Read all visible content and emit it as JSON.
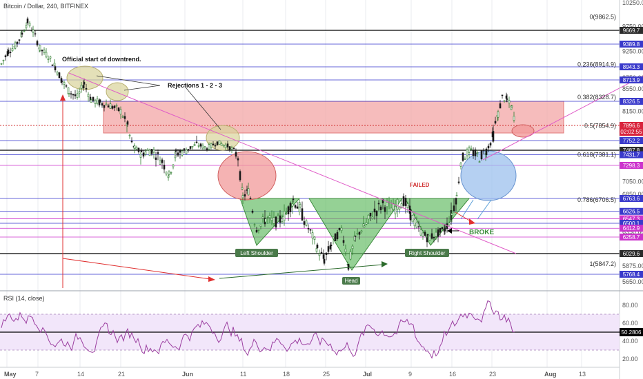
{
  "header": {
    "title": "Bitcoin / Dollar, 240, BITFINEX"
  },
  "rsi_header": {
    "title": "RSI (14, close)"
  },
  "colors": {
    "grid": "#e8ebef",
    "black_line": "#000000",
    "blue_line": "#3333cc",
    "magenta_line": "#cc33cc",
    "red_zone": "#f3a6a6",
    "green_pattern": "#5cb85c",
    "candle_up": "#2a7a2a",
    "candle_down": "#1a1a1a",
    "rsi_line": "#9b3ea0",
    "rsi_band": "#f2e6fa",
    "dark_box": "#2b2b2b",
    "blue_box": "#3a3acb",
    "red_box": "#d9233c",
    "magenta_box": "#cc33cc"
  },
  "chart_data": [
    {
      "type": "candlestick",
      "title": "Bitcoin / Dollar, 240, BITFINEX",
      "x_ticks": [
        "May",
        "7",
        "14",
        "21",
        "Jun",
        "11",
        "18",
        "25",
        "Jul",
        "9",
        "16",
        "23",
        "Aug",
        "13"
      ],
      "y_ticks": [
        10250.0,
        9750.0,
        9250.0,
        8750.0,
        8550.0,
        8150.0,
        7750.0,
        7050.0,
        6850.0,
        6350.0,
        5875.0,
        5650.0
      ],
      "ylim": [
        5600,
        10300
      ],
      "price_labels": [
        {
          "value": 9669.7,
          "color": "dark"
        },
        {
          "value": 9389.8,
          "color": "blue"
        },
        {
          "value": 8943.3,
          "color": "blue"
        },
        {
          "value": 8713.9,
          "color": "blue"
        },
        {
          "value": 8326.5,
          "color": "blue"
        },
        {
          "value": 7896.6,
          "color": "red",
          "text": "7896.6",
          "sub": "02:02:55"
        },
        {
          "value": 7752.2,
          "color": "blue"
        },
        {
          "value": 7487.8,
          "color": "dark"
        },
        {
          "value": 7431.7,
          "color": "blue"
        },
        {
          "value": 7298.3,
          "color": "magenta"
        },
        {
          "value": 6763.6,
          "color": "blue"
        },
        {
          "value": 6626.5,
          "color": "blue"
        },
        {
          "value": 6547.3,
          "color": "magenta"
        },
        {
          "value": 6500.1,
          "color": "blue"
        },
        {
          "value": 6412.9,
          "color": "magenta"
        },
        {
          "value": 6258.7,
          "color": "magenta"
        },
        {
          "value": 6029.6,
          "color": "dark"
        },
        {
          "value": 5768.4,
          "color": "blue"
        }
      ],
      "fib_levels": [
        {
          "ratio": "0",
          "price": 9862.5,
          "label": "0(9862.5)"
        },
        {
          "ratio": "0.236",
          "price": 8914.9,
          "label": "0.236(8914.9)"
        },
        {
          "ratio": "0.382",
          "price": 8328.7,
          "label": "0.382(8328.7)"
        },
        {
          "ratio": "0.5",
          "price": 7854.9,
          "label": "0.5(7854.9)"
        },
        {
          "ratio": "0.618",
          "price": 7381.1,
          "label": "0.618(7381.1)"
        },
        {
          "ratio": "0.786",
          "price": 6706.5,
          "label": "0.786(6706.5)"
        },
        {
          "ratio": "1",
          "price": 5847.2,
          "label": "1(5847.2)"
        }
      ],
      "annotations": [
        "Official start of downtrend.",
        "Rejections 1 - 2 - 3",
        "FAILED",
        "BROKE",
        "Left Shoulder",
        "Head",
        "Right Shoulder"
      ]
    },
    {
      "type": "line",
      "title": "RSI (14, close)",
      "y_ticks": [
        80.0,
        60.0,
        40.0,
        20.0
      ],
      "ylim": [
        15,
        95
      ],
      "current": "50.2806",
      "bands": [
        70,
        30
      ]
    }
  ],
  "annotations": {
    "downtrend": "Official start of downtrend.",
    "rejections": "Rejections 1 - 2 - 3",
    "failed": "FAILED",
    "broke": "BROKE",
    "left_shoulder": "Left Shoulder",
    "head": "Head",
    "right_shoulder": "Right Shoulder"
  }
}
